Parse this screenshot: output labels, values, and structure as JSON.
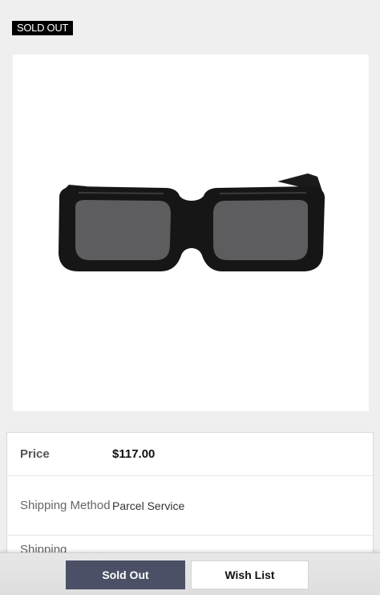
{
  "badge": {
    "label": "SOLD OUT"
  },
  "product_image": {
    "icon": "sunglasses-image"
  },
  "details": {
    "price": {
      "label": "Price",
      "value": "$117.00"
    },
    "shipping": {
      "label": "Shipping Method",
      "value": "Parcel Service"
    },
    "third": {
      "label": "Shipping"
    }
  },
  "actions": {
    "sold_out_label": "Sold Out",
    "wish_list_label": "Wish List"
  },
  "colors": {
    "sold_out_button": "#4b5066",
    "badge_bg": "#000000"
  }
}
